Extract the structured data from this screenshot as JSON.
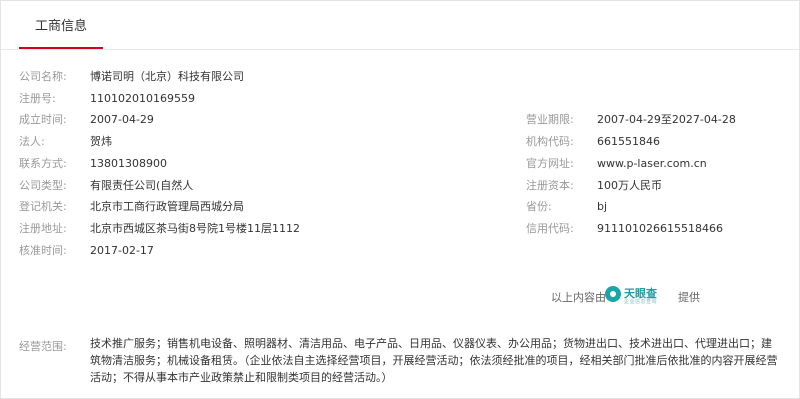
{
  "tab": {
    "label": "工商信息"
  },
  "left": [
    {
      "label": "公司名称:",
      "value": "博诺司明（北京）科技有限公司"
    },
    {
      "label": "注册号:",
      "value": "110102010169559"
    },
    {
      "label": "成立时间:",
      "value": "2007-04-29"
    },
    {
      "label": "法人:",
      "value": "贺炜"
    },
    {
      "label": "联系方式:",
      "value": "13801308900"
    },
    {
      "label": "公司类型:",
      "value": "有限责任公司(自然人"
    },
    {
      "label": "登记机关:",
      "value": "北京市工商行政管理局西城分局"
    },
    {
      "label": "注册地址:",
      "value": "北京市西城区茶马街8号院1号楼11层1112"
    },
    {
      "label": "核准时间:",
      "value": "2017-02-17"
    }
  ],
  "right": [
    {
      "label": "营业期限:",
      "value": "2007-04-29至2027-04-28"
    },
    {
      "label": "机构代码:",
      "value": "661551846"
    },
    {
      "label": "官方网址:",
      "value": "www.p-laser.com.cn"
    },
    {
      "label": "注册资本:",
      "value": "100万人民币"
    },
    {
      "label": "省份:",
      "value": "bj"
    },
    {
      "label": "信用代码:",
      "value": "911101026615518466"
    }
  ],
  "provider": {
    "prefix": "以上内容由",
    "logo_name": "天眼查",
    "logo_sub": "企业信息查询",
    "suffix": "提供",
    "logo_color": "#1a9ea0"
  },
  "scope": {
    "label": "经营范围:",
    "value": "技术推广服务；销售机电设备、照明器材、清洁用品、电子产品、日用品、仪器仪表、办公用品；货物进出口、技术进出口、代理进出口；建筑物清洁服务；机械设备租赁。（企业依法自主选择经营项目，开展经营活动；依法须经批准的项目，经相关部门批准后依批准的内容开展经营活动；不得从事本市产业政策禁止和限制类项目的经营活动。）"
  },
  "colors": {
    "accent": "#d0021b",
    "label": "#999999",
    "value": "#333333"
  }
}
